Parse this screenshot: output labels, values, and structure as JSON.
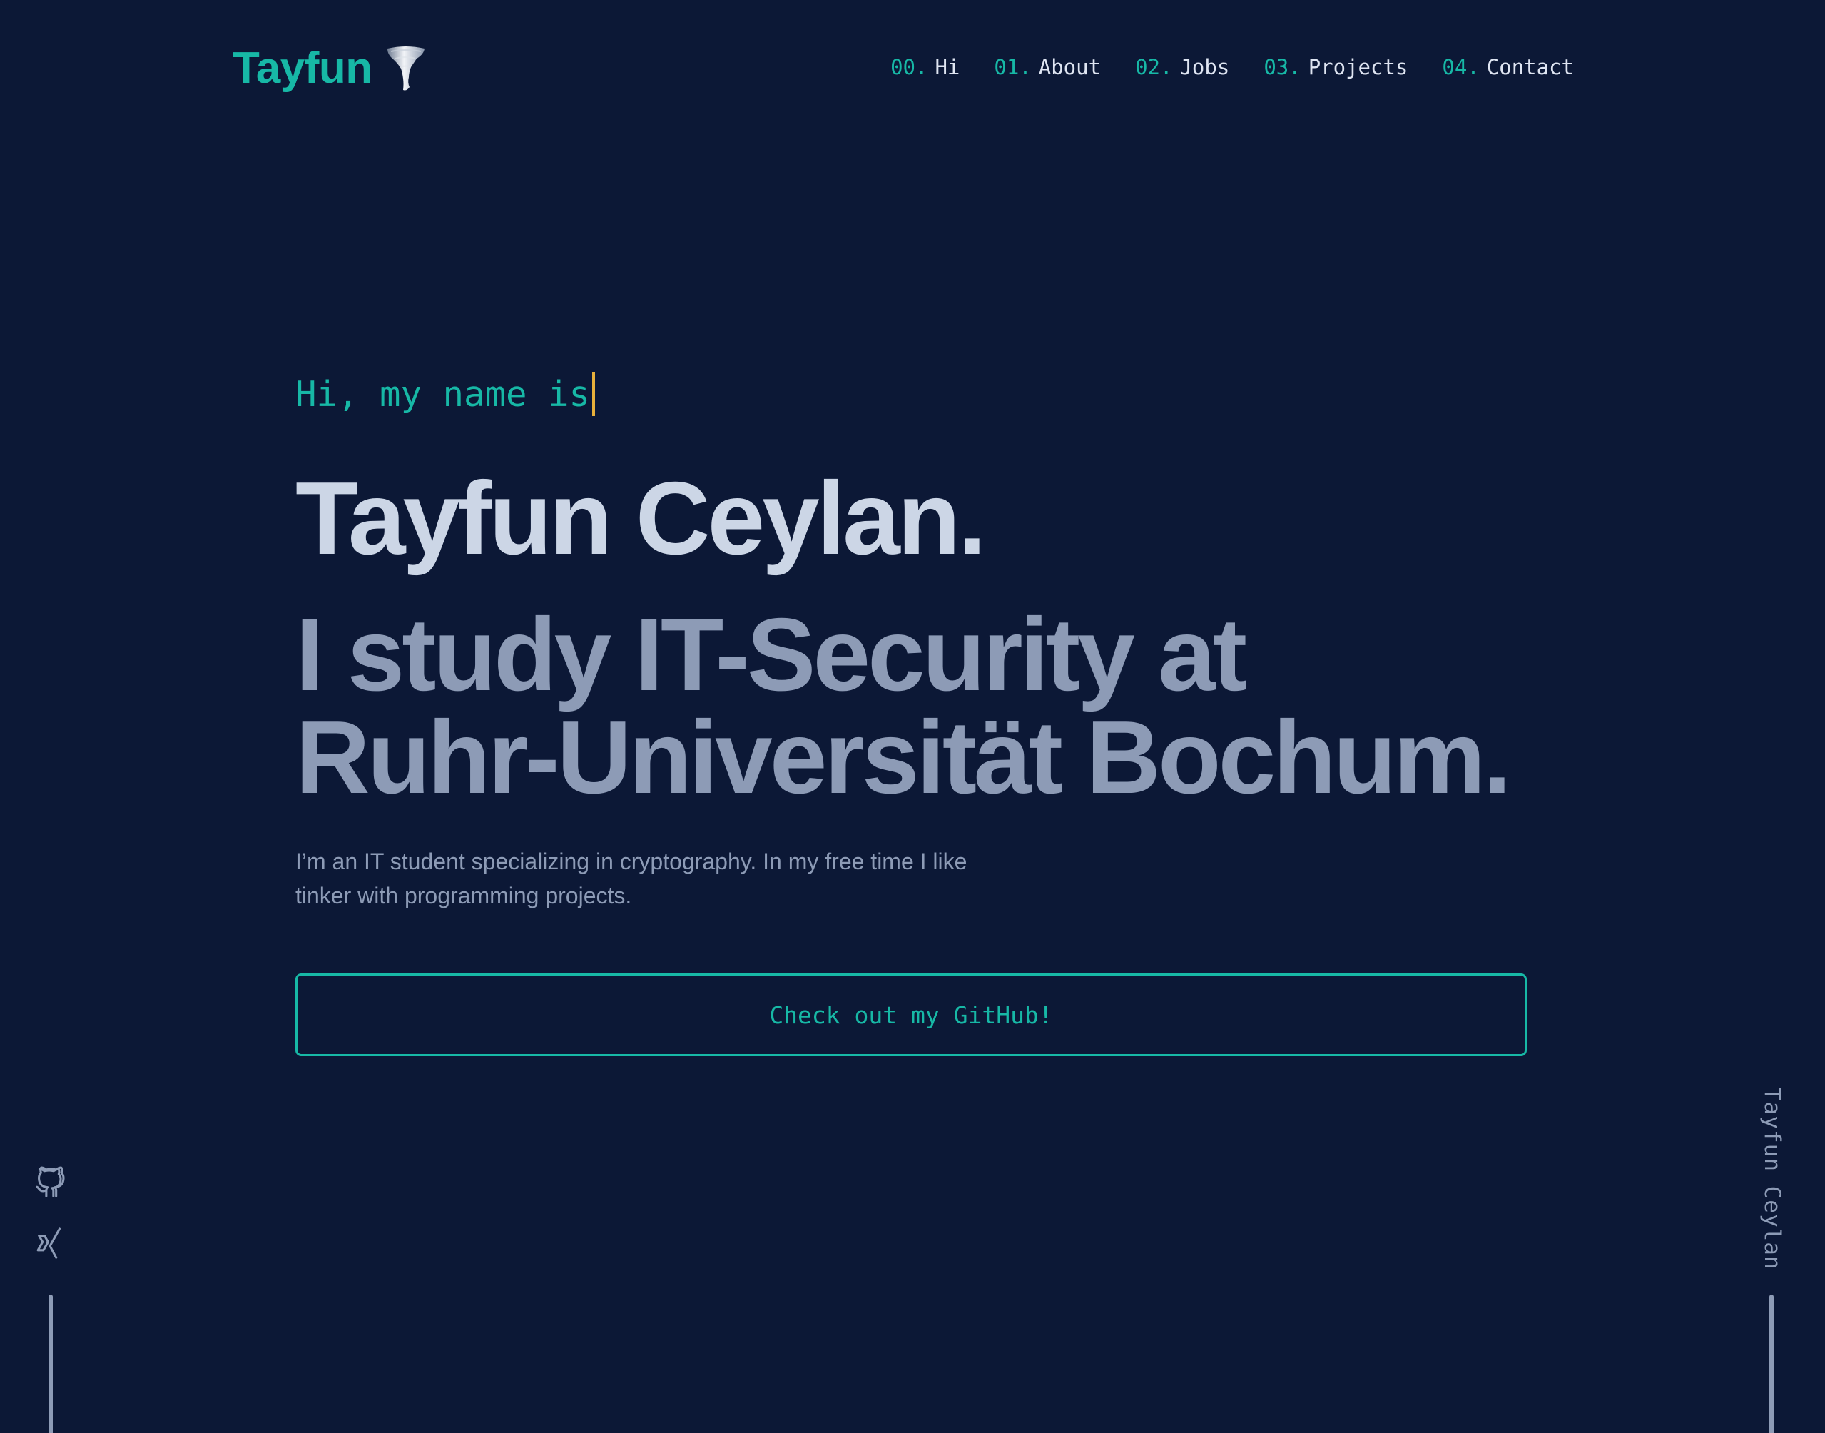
{
  "header": {
    "logo_text": "Tayfun",
    "logo_icon": "tornado-icon",
    "nav": [
      {
        "num": "00.",
        "label": "Hi"
      },
      {
        "num": "01.",
        "label": "About"
      },
      {
        "num": "02.",
        "label": "Jobs"
      },
      {
        "num": "03.",
        "label": "Projects"
      },
      {
        "num": "04.",
        "label": "Contact"
      }
    ]
  },
  "hero": {
    "greeting": "Hi, my name is",
    "name": "Tayfun Ceylan.",
    "headline_line1": "I study IT-Security at",
    "headline_line2": "Ruhr-Universität Bochum.",
    "intro": "I’m an IT student specializing in cryptography. In my free time I like tinker with programming projects.",
    "cta_label": "Check out my GitHub!"
  },
  "sidebar_left": {
    "icons": [
      "github-icon",
      "xing-icon"
    ]
  },
  "sidebar_right": {
    "vertical_text": "Tayfun Ceylan"
  },
  "colors": {
    "background": "#0c1836",
    "accent": "#17b8a6",
    "name_text": "#ccd6e6",
    "muted_text": "#8d9bb6",
    "nav_text": "#dfe5f2",
    "cursor": "#e8b03b"
  }
}
